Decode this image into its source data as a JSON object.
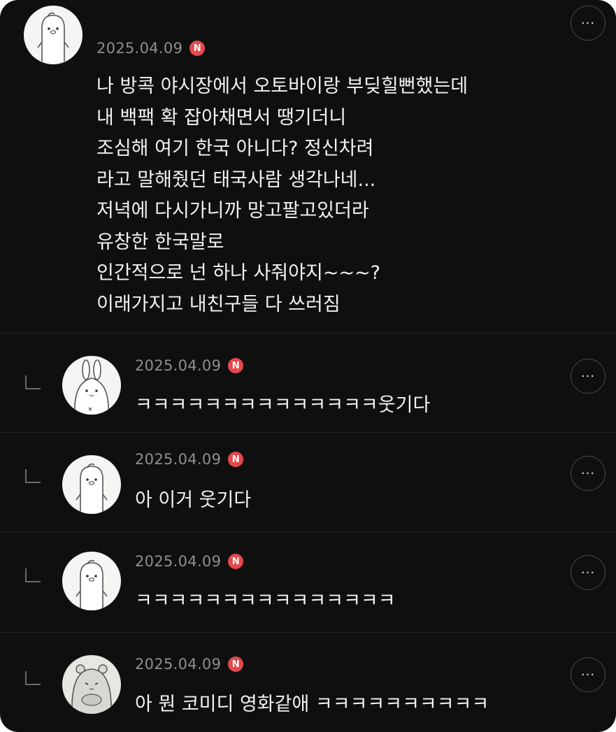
{
  "post": {
    "date": "2025.04.09",
    "badge": "N",
    "more_label": "···",
    "body": "나 방콕 야시장에서 오토바이랑 부딪힐뻔했는데\n내 백팩 확 잡아채면서 땡기더니\n조심해 여기 한국 아니다? 정신차려\n라고 말해줬던 태국사람 생각나네...\n저녁에 다시가니까 망고팔고있더라\n유창한 한국말로\n인간적으로 넌 하나 사줘야지~~~?\n이래가지고 내친구들 다 쓰러짐"
  },
  "replies": [
    {
      "date": "2025.04.09",
      "badge": "N",
      "text": "ㅋㅋㅋㅋㅋㅋㅋㅋㅋㅋㅋㅋㅋㅋ웃기다",
      "more_label": "···"
    },
    {
      "date": "2025.04.09",
      "badge": "N",
      "text": "아 이거 웃기다",
      "more_label": "···"
    },
    {
      "date": "2025.04.09",
      "badge": "N",
      "text": "ㅋㅋㅋㅋㅋㅋㅋㅋㅋㅋㅋㅋㅋㅋㅋ",
      "more_label": "···"
    },
    {
      "date": "2025.04.09",
      "badge": "N",
      "text": "아 뭔 코미디 영화같애 ㅋㅋㅋㅋㅋㅋㅋㅋㅋㅋ",
      "more_label": "···"
    }
  ],
  "colors": {
    "background": "#0f0f10",
    "badge": "#e5484d",
    "date": "#8e8e93",
    "text": "#f2f2f2"
  }
}
